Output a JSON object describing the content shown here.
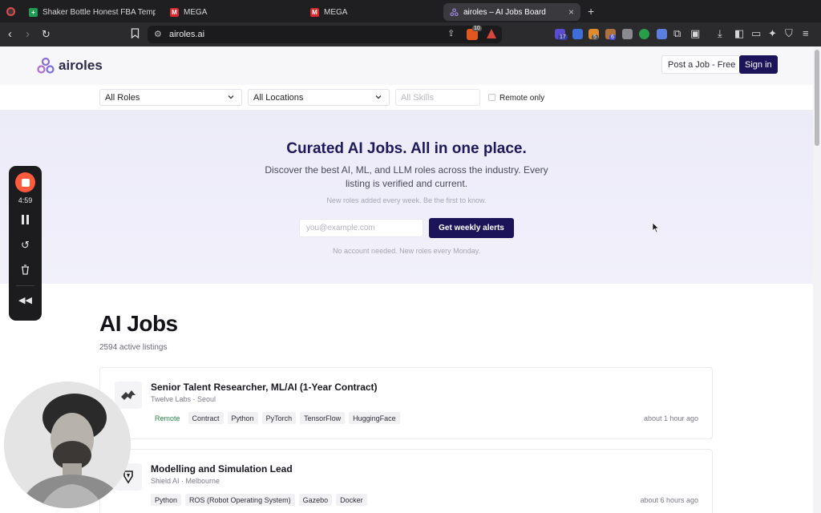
{
  "browser": {
    "tabs": [
      {
        "title": "Shaker Bottle Honest FBA Templat",
        "icon": "sheets-icon",
        "color": "#1f9d55"
      },
      {
        "title": "MEGA",
        "icon": "mega-icon",
        "color": "#d9272e"
      },
      {
        "title": "MEGA",
        "icon": "mega-icon",
        "color": "#d9272e"
      },
      {
        "title": "airoles – AI Jobs Board",
        "icon": "airoles-icon",
        "color": "#8a6fd1"
      }
    ],
    "new_tab": "+",
    "url": "airoles.ai",
    "brave_badge": "10",
    "ext_badges": [
      "17",
      "5",
      "6"
    ]
  },
  "site": {
    "brand": "airoles",
    "post_job": "Post a Job - Free",
    "sign_in": "Sign in"
  },
  "filters": {
    "roles": "All Roles",
    "locations": "All Locations",
    "skills_placeholder": "All Skills",
    "remote_only": "Remote only"
  },
  "hero": {
    "title": "Curated AI Jobs. All in one place.",
    "subtitle": "Discover the best AI, ML, and LLM roles across the industry. Every listing is verified and current.",
    "note": "New roles added every week. Be the first to know.",
    "email_placeholder": "you@example.com",
    "cta": "Get weekly alerts",
    "note2": "No account needed. New roles every Monday."
  },
  "jobs": {
    "heading": "AI Jobs",
    "count": "2594 active listings",
    "items": [
      {
        "title": "Senior Talent Researcher, ML/AI (1-Year Contract)",
        "meta": "Twelve Labs · Seoul",
        "tags": [
          "Remote",
          "Contract",
          "Python",
          "PyTorch",
          "TensorFlow",
          "HuggingFace"
        ],
        "time": "about 1 hour ago"
      },
      {
        "title": "Modelling and Simulation Lead",
        "meta": "Shield AI · Melbourne",
        "tags": [
          "Python",
          "ROS (Robot Operating System)",
          "Gazebo",
          "Docker"
        ],
        "time": "about 6 hours ago"
      }
    ]
  },
  "recorder": {
    "timer": "4:59"
  },
  "colors": {
    "brand_navy": "#1b1459",
    "hero_bg": "#ecebf8",
    "remote_green": "#2c8a4b",
    "record_red": "#ff5a3c"
  }
}
